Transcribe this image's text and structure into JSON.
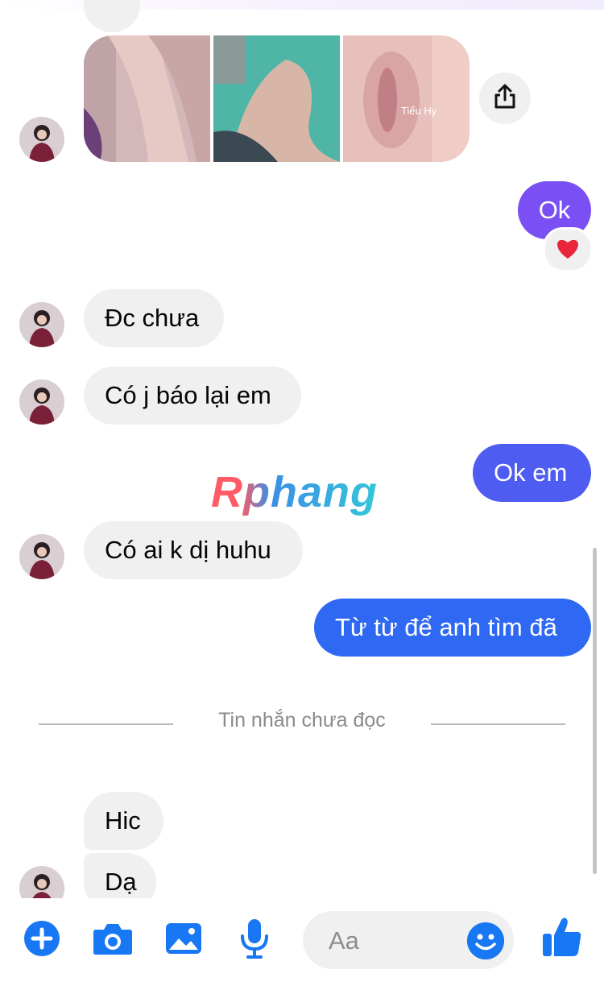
{
  "colors": {
    "accent_blue": "#1877f2",
    "outgoing_purple": "#7a50f5",
    "outgoing_indigo": "#4e5cf2",
    "outgoing_blue": "#2f68f2",
    "incoming_bg": "#f0f0f0",
    "heart": "#e8253a"
  },
  "photos": {
    "caption": "Tiểu Hy"
  },
  "messages": {
    "ok": "Ok",
    "dc_chua": "Đc chưa",
    "co_j": "Có j báo lại em",
    "ok_em": "Ok em",
    "co_ai": "Có ai k dị huhu",
    "tu_tu": "Từ từ để anh tìm đã",
    "hic": "Hic",
    "da": "Dạ"
  },
  "reaction": {
    "icon": "heart-icon"
  },
  "watermark": "Rphang",
  "divider": {
    "label": "Tin nhắn chưa đọc"
  },
  "composer": {
    "placeholder": "Aa",
    "icons": [
      "plus-icon",
      "camera-icon",
      "image-icon",
      "microphone-icon",
      "emoji-icon",
      "thumbs-up-icon"
    ]
  }
}
